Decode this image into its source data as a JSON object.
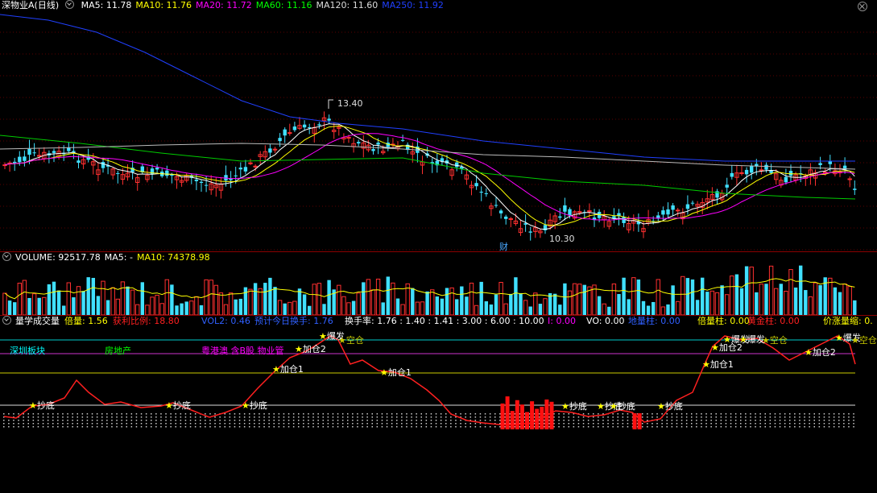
{
  "main": {
    "title": "深物业A(日线)",
    "ma": [
      {
        "label": "MA5: 11.78",
        "color": "#ffffff"
      },
      {
        "label": "MA10: 11.76",
        "color": "#ffff00"
      },
      {
        "label": "MA20: 11.72",
        "color": "#ff00ff"
      },
      {
        "label": "MA60: 11.16",
        "color": "#00ff00"
      },
      {
        "label": "MA120: 11.60",
        "color": "#dddddd"
      },
      {
        "label": "MA250: 11.92",
        "color": "#2040ff"
      }
    ],
    "high_label": "13.40",
    "low_label": "10.30",
    "fin_badge": "财"
  },
  "volume": {
    "title": "VOLUME: 92517.78",
    "ma5": "MA5: -",
    "ma10": "MA10: 74378.98"
  },
  "indicator": {
    "title": "量学成交量",
    "items": [
      {
        "label": "倍量: 1.56",
        "color": "#ffff00"
      },
      {
        "label": "获利比例: 18.80",
        "color": "#ff2020"
      },
      {
        "label": "VOL2: 0.46",
        "color": "#3060ff"
      },
      {
        "label": "预计今日换手: 1.76",
        "color": "#3060ff"
      },
      {
        "label": "换手率: 1.76 : 1.40 : 1.41 : 3.00 : 6.00 : 10.00",
        "color": "#ffffff"
      },
      {
        "label": "I: 0.00",
        "color": "#ff00ff"
      },
      {
        "label": "VO: 0.00",
        "color": "#ffffff"
      },
      {
        "label": "地量柱: 0.00",
        "color": "#3060ff"
      },
      {
        "label": "倍量柱: 0.00",
        "color": "#ffff00"
      },
      {
        "label": "黄金柱: 0.00",
        "color": "#ff2020"
      },
      {
        "label": "价涨量缩: 0.",
        "color": "#ffff00"
      }
    ],
    "sector_labels": [
      {
        "text": "深圳板块",
        "color": "#00ffff"
      },
      {
        "text": "房地产",
        "color": "#00ff00"
      },
      {
        "text": "粤港澳 含B股 物业管",
        "color": "#ff00ff"
      }
    ],
    "signals": [
      {
        "text": "抄底"
      },
      {
        "text": "抄底"
      },
      {
        "text": "抄底"
      },
      {
        "text": "加仓1"
      },
      {
        "text": "加仓2"
      },
      {
        "text": "爆发"
      },
      {
        "text": "空仓"
      },
      {
        "text": "加仓1"
      },
      {
        "text": "抄底"
      },
      {
        "text": "抄底"
      },
      {
        "text": "抄底"
      },
      {
        "text": "抄底"
      },
      {
        "text": "加仓1"
      },
      {
        "text": "加仓2"
      },
      {
        "text": "爆发"
      },
      {
        "text": "爆发"
      },
      {
        "text": "空仓"
      },
      {
        "text": "加仓2"
      },
      {
        "text": "爆发"
      },
      {
        "text": "空仓"
      }
    ]
  }
}
